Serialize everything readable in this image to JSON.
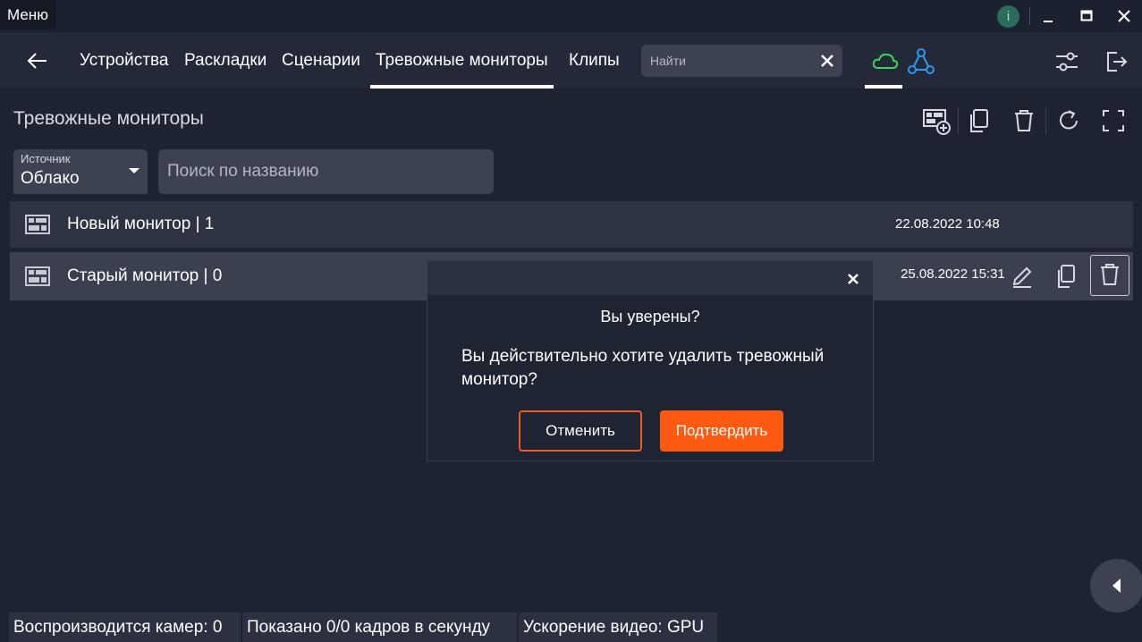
{
  "titlebar": {
    "menu_label": "Меню",
    "info_glyph": "i"
  },
  "nav": {
    "tabs": [
      "Устройства",
      "Раскладки",
      "Сценарии",
      "Тревожные мониторы",
      "Клипы"
    ],
    "active_tab": "Тревожные мониторы",
    "search_placeholder": "Найти",
    "cloud_color": "#3fd15a",
    "network_color": "#2b9af0"
  },
  "page": {
    "title": "Тревожные мониторы"
  },
  "filters": {
    "source_label": "Источник",
    "source_value": "Облако",
    "name_search_placeholder": "Поиск по названию"
  },
  "monitors": [
    {
      "name": "Новый монитор  | 1",
      "date": "22.08.2022 10:48"
    },
    {
      "name": "Старый монитор  | 0",
      "date": "25.08.2022 15:31"
    }
  ],
  "dialog": {
    "title": "Вы уверены?",
    "message": "Вы действительно хотите удалить тревожный монитор?",
    "cancel_label": "Отменить",
    "confirm_label": "Подтвердить",
    "accent_color": "#ff5a12"
  },
  "statusbar": {
    "cameras": "Воспроизводится камер: 0",
    "fps": "Показано 0/0 кадров в секунду",
    "accel": "Ускорение видео: GPU"
  }
}
